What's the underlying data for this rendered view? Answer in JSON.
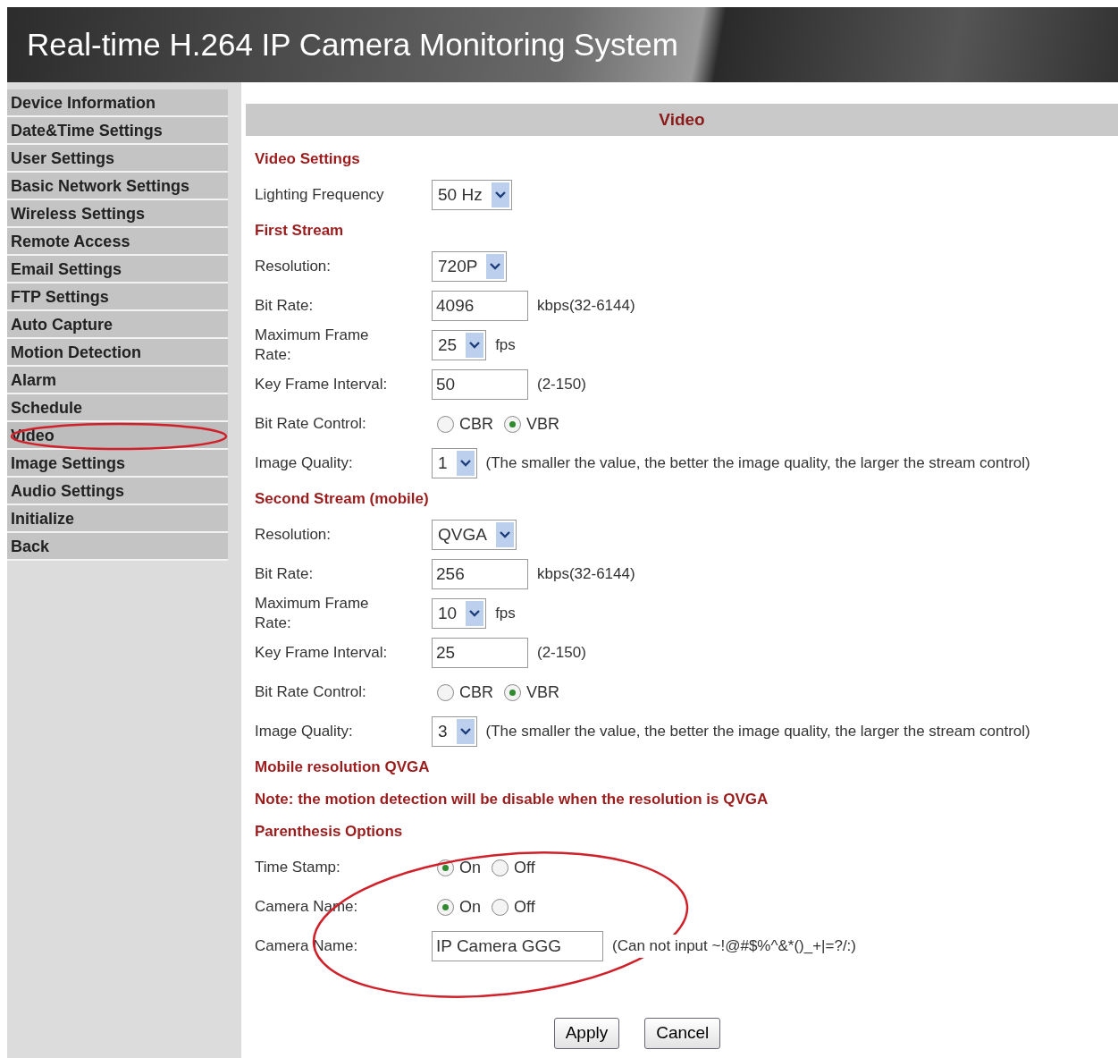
{
  "header": {
    "title": "Real-time H.264 IP Camera Monitoring System"
  },
  "sidebar": {
    "items": [
      {
        "label": "Device Information",
        "selected": false
      },
      {
        "label": "Date&Time Settings",
        "selected": false
      },
      {
        "label": "User Settings",
        "selected": false
      },
      {
        "label": "Basic Network Settings",
        "selected": false
      },
      {
        "label": "Wireless Settings",
        "selected": false
      },
      {
        "label": "Remote Access",
        "selected": false
      },
      {
        "label": "Email Settings",
        "selected": false
      },
      {
        "label": "FTP Settings",
        "selected": false
      },
      {
        "label": "Auto Capture",
        "selected": false
      },
      {
        "label": "Motion Detection",
        "selected": false
      },
      {
        "label": "Alarm",
        "selected": false
      },
      {
        "label": "Schedule",
        "selected": false
      },
      {
        "label": "Video",
        "selected": true
      },
      {
        "label": "Image Settings",
        "selected": false
      },
      {
        "label": "Audio Settings",
        "selected": false
      },
      {
        "label": "Initialize",
        "selected": false
      },
      {
        "label": "Back",
        "selected": false
      }
    ]
  },
  "panel": {
    "title": "Video"
  },
  "rows": [
    {
      "kind": "heading",
      "text": "Video Settings"
    },
    {
      "kind": "select",
      "label": "Lighting Frequency",
      "value": "50 Hz"
    },
    {
      "kind": "heading",
      "text": "First Stream"
    },
    {
      "kind": "select",
      "label": "Resolution:",
      "value": "720P"
    },
    {
      "kind": "input",
      "label": "Bit Rate:",
      "value": "4096",
      "hint": "kbps(32-6144)"
    },
    {
      "kind": "select",
      "label": "Maximum Frame Rate:",
      "value": "25",
      "hint": "fps"
    },
    {
      "kind": "input",
      "label": "Key Frame Interval:",
      "value": "50",
      "hint": "(2-150)"
    },
    {
      "kind": "radio",
      "label": "Bit Rate Control:",
      "options": [
        {
          "label": "CBR",
          "selected": false
        },
        {
          "label": "VBR",
          "selected": true
        }
      ]
    },
    {
      "kind": "select",
      "label": "Image Quality:",
      "value": "1",
      "hint": "(The smaller the value, the better the image quality, the larger the stream control)"
    },
    {
      "kind": "heading",
      "text": "Second Stream (mobile)"
    },
    {
      "kind": "select",
      "label": "Resolution:",
      "value": "QVGA"
    },
    {
      "kind": "input",
      "label": "Bit Rate:",
      "value": "256",
      "hint": "kbps(32-6144)"
    },
    {
      "kind": "select",
      "label": "Maximum Frame Rate:",
      "value": "10",
      "hint": "fps"
    },
    {
      "kind": "input",
      "label": "Key Frame Interval:",
      "value": "25",
      "hint": "(2-150)"
    },
    {
      "kind": "radio",
      "label": "Bit Rate Control:",
      "options": [
        {
          "label": "CBR",
          "selected": false
        },
        {
          "label": "VBR",
          "selected": true
        }
      ]
    },
    {
      "kind": "select",
      "label": "Image Quality:",
      "value": "3",
      "hint": "(The smaller the value, the better the image quality, the larger the stream control)"
    },
    {
      "kind": "heading",
      "text": "Mobile resolution QVGA"
    },
    {
      "kind": "heading",
      "text": "Note: the motion detection will be disable when the resolution is QVGA"
    },
    {
      "kind": "heading",
      "text": "Parenthesis Options"
    },
    {
      "kind": "radio",
      "label": "Time Stamp:",
      "options": [
        {
          "label": "On",
          "selected": true
        },
        {
          "label": "Off",
          "selected": false
        }
      ]
    },
    {
      "kind": "radio",
      "label": "Camera Name:",
      "options": [
        {
          "label": "On",
          "selected": true
        },
        {
          "label": "Off",
          "selected": false
        }
      ]
    },
    {
      "kind": "input",
      "label": "Camera Name:",
      "value": "IP Camera GGG",
      "hint": "(Can not input ~!@#$%^&*()_+|=?/:)"
    }
  ],
  "buttons": [
    "Apply",
    "Cancel"
  ]
}
